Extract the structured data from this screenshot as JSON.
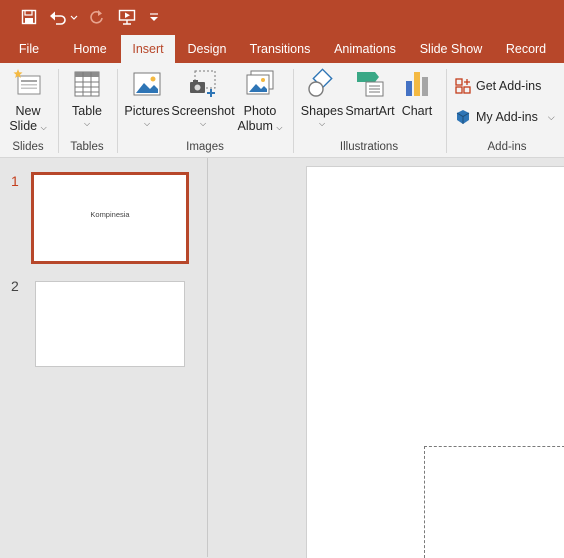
{
  "qat": {
    "save_icon": "save-icon",
    "undo_icon": "undo-icon",
    "redo_icon": "redo-icon",
    "present_icon": "present-from-start-icon",
    "customize_icon": "customize-qat-icon"
  },
  "tabs": [
    {
      "label": "File"
    },
    {
      "label": "Home"
    },
    {
      "label": "Insert",
      "active": true
    },
    {
      "label": "Design"
    },
    {
      "label": "Transitions"
    },
    {
      "label": "Animations"
    },
    {
      "label": "Slide Show"
    },
    {
      "label": "Record"
    }
  ],
  "ribbon": {
    "new_slide": {
      "line1": "New",
      "line2": "Slide"
    },
    "table": {
      "label": "Table"
    },
    "pictures": {
      "label": "Pictures"
    },
    "screenshot": {
      "label": "Screenshot"
    },
    "photo_album": {
      "line1": "Photo",
      "line2": "Album"
    },
    "shapes": {
      "label": "Shapes"
    },
    "smartart": {
      "label": "SmartArt"
    },
    "chart": {
      "label": "Chart"
    },
    "get_addins": {
      "label": "Get Add-ins"
    },
    "my_addins": {
      "label": "My Add-ins"
    },
    "groups": {
      "slides": "Slides",
      "tables": "Tables",
      "images": "Images",
      "illustrations": "Illustrations",
      "addins": "Add-ins"
    }
  },
  "slides": [
    {
      "number": "1",
      "title": "Kompinesia",
      "selected": true
    },
    {
      "number": "2",
      "title": ""
    }
  ],
  "colors": {
    "accent": "#b7472a",
    "ribbon_bg": "#f3f3f3",
    "workspace_bg": "#e6e6e6"
  }
}
